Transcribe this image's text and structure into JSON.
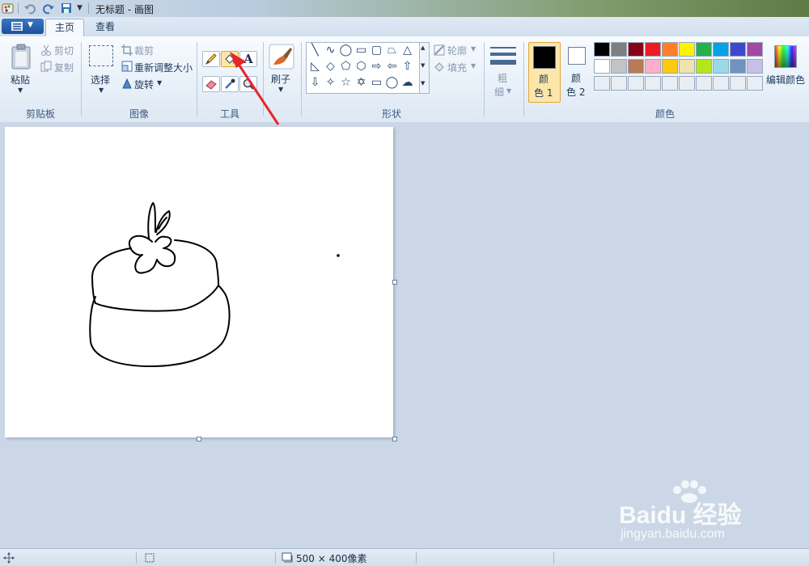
{
  "window": {
    "title": "无标题 - 画图"
  },
  "tabs": [
    {
      "label": "主页"
    },
    {
      "label": "查看"
    }
  ],
  "clipboard": {
    "paste_label": "粘贴",
    "cut_label": "剪切",
    "copy_label": "复制",
    "group_label": "剪贴板"
  },
  "image": {
    "select_label": "选择",
    "crop_label": "裁剪",
    "resize_label": "重新调整大小",
    "rotate_label": "旋转",
    "group_label": "图像"
  },
  "tools": {
    "group_label": "工具",
    "selected_tool": "fill-bucket",
    "text_tool_glyph": "A"
  },
  "brushes": {
    "label": "刷子"
  },
  "shapes": {
    "group_label": "形状",
    "outline_label": "轮廓",
    "fill_label": "填充"
  },
  "size": {
    "label_line1": "粗",
    "label_line2": "细"
  },
  "colors": {
    "group_label": "颜色",
    "color1_label_a": "颜",
    "color1_label_b": "色 1",
    "color2_label_a": "颜",
    "color2_label_b": "色 2",
    "color1": "#000000",
    "color2": "#ffffff",
    "edit_label": "编辑颜色",
    "palette_row1": [
      "#000000",
      "#7f7f7f",
      "#880015",
      "#ed1c24",
      "#ff7f27",
      "#fff200",
      "#22b14c",
      "#00a2e8",
      "#3f48cc",
      "#a349a4"
    ],
    "palette_row2": [
      "#ffffff",
      "#c3c3c3",
      "#b97a57",
      "#ffaec9",
      "#ffc90e",
      "#efe4b0",
      "#b5e61d",
      "#99d9ea",
      "#7092be",
      "#c8bfe7"
    ]
  },
  "status": {
    "canvas_size": "500 × 400像素"
  },
  "watermark": {
    "brand": "Baidu 经验",
    "url": "jingyan.baidu.com"
  }
}
